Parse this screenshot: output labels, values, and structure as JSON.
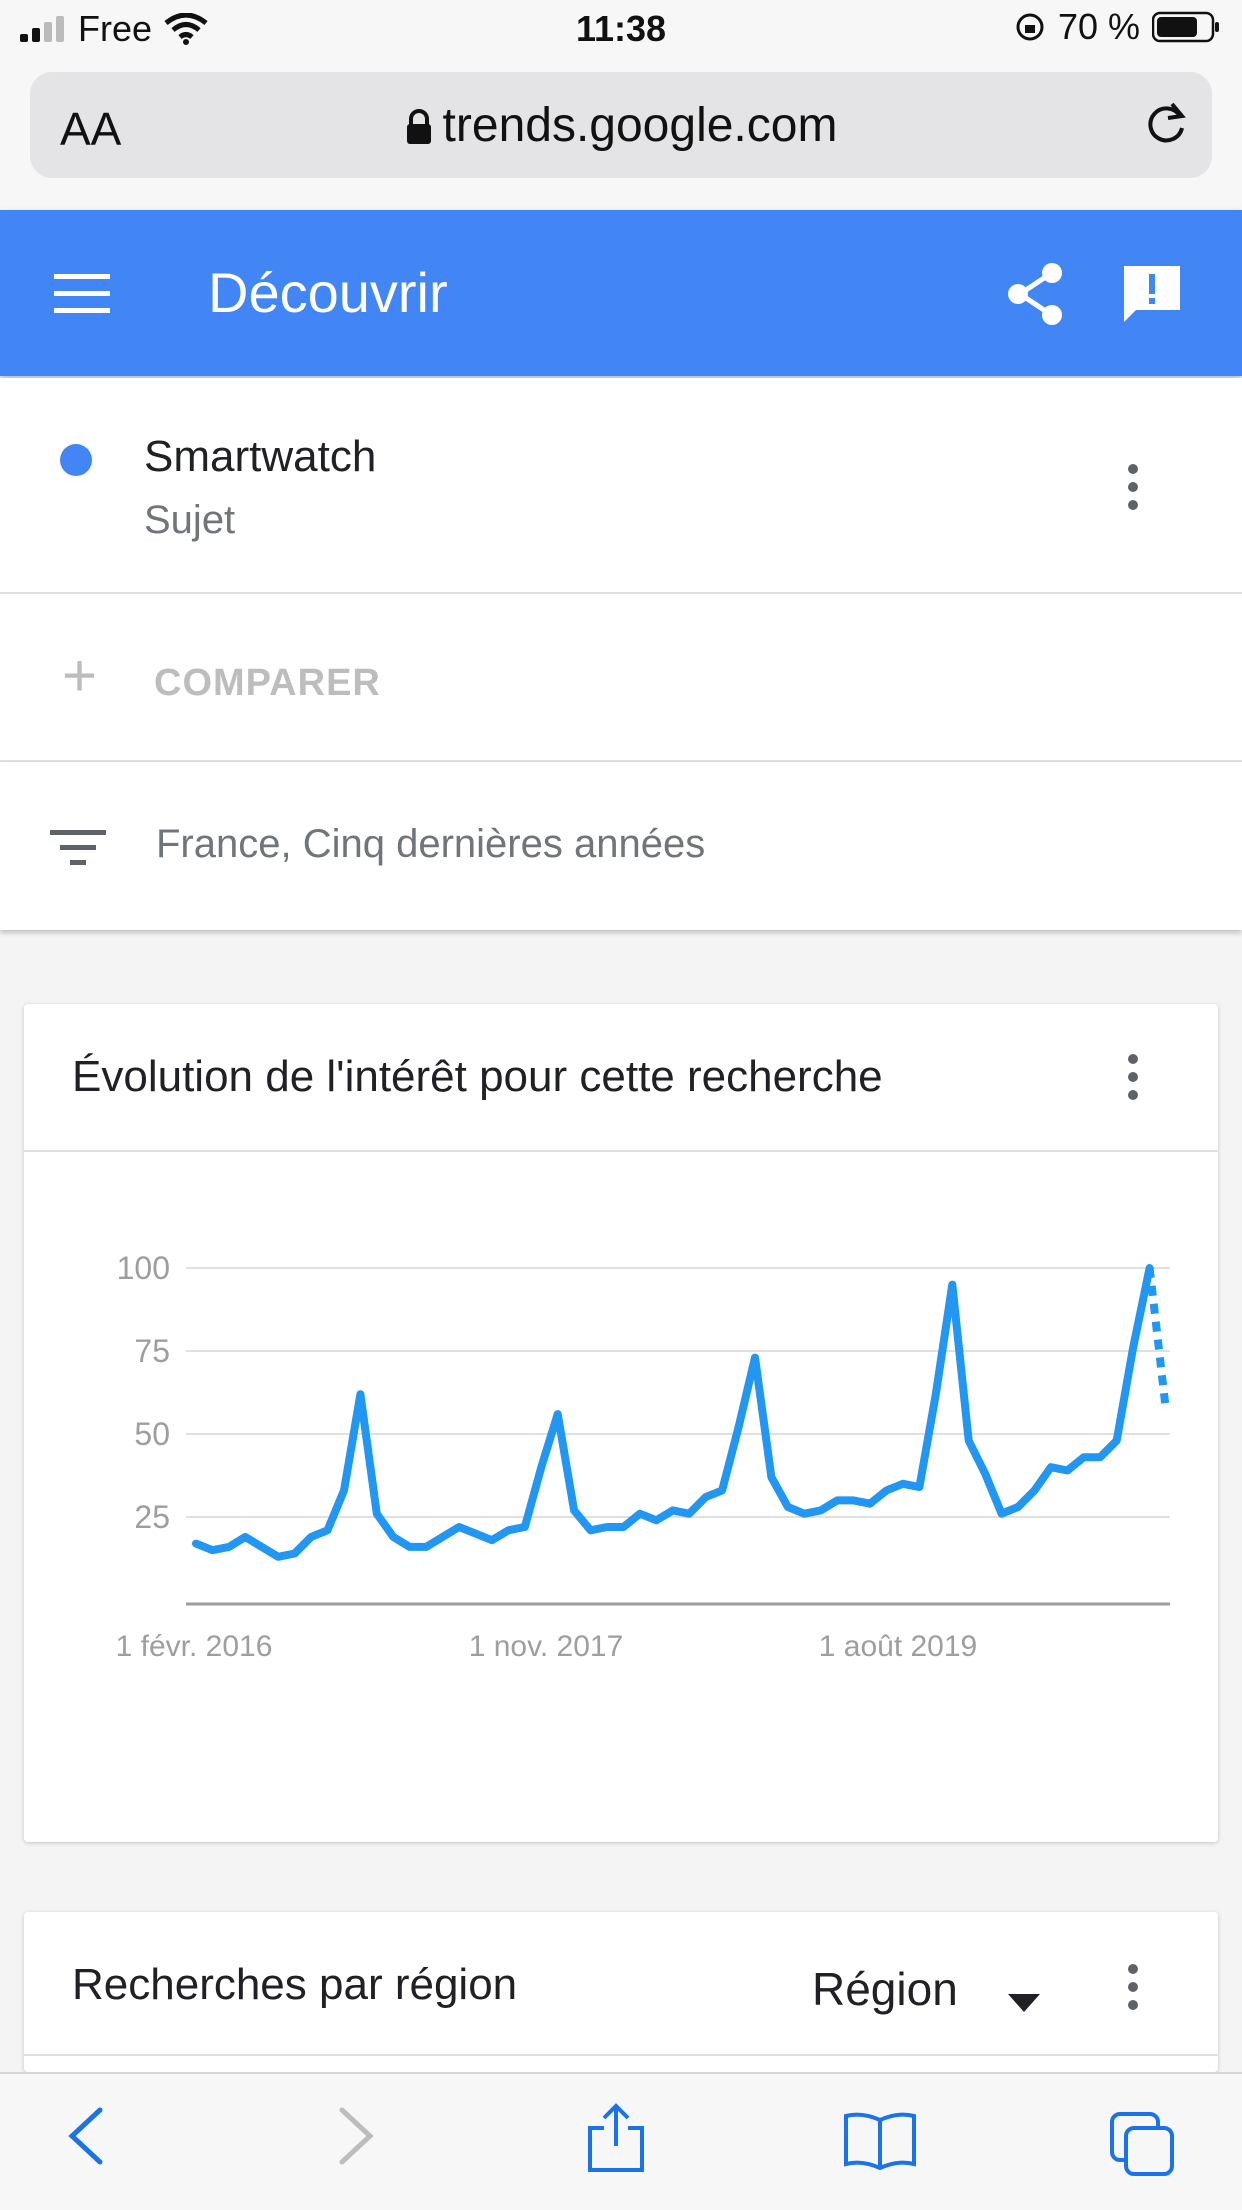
{
  "status": {
    "carrier": "Free",
    "time": "11:38",
    "battery": "70 %"
  },
  "browser": {
    "text_size_label": "AA",
    "host": "trends.google.com"
  },
  "appbar": {
    "title": "Découvrir"
  },
  "term": {
    "name": "Smartwatch",
    "type": "Sujet"
  },
  "compare": {
    "label": "COMPARER"
  },
  "filter": {
    "label": "France, Cinq dernières années"
  },
  "interest_card": {
    "title": "Évolution de l'intérêt pour cette recherche"
  },
  "region_card": {
    "title": "Recherches par région",
    "selector": "Région"
  },
  "colors": {
    "brand_blue": "#4285f4",
    "series_blue": "#2196f3"
  },
  "chart_data": {
    "type": "line",
    "ylim": [
      0,
      100
    ],
    "y_ticks": [
      "100",
      "75",
      "50",
      "25"
    ],
    "x_tick_labels": [
      "1 févr. 2016",
      "1 nov. 2017",
      "1 août 2019"
    ],
    "series": [
      {
        "values": [
          17,
          15,
          16,
          19,
          16,
          13,
          14,
          19,
          21,
          33,
          62,
          26,
          19,
          16,
          16,
          19,
          22,
          20,
          18,
          21,
          22,
          40,
          56,
          27,
          21,
          22,
          22,
          26,
          24,
          27,
          26,
          31,
          33,
          52,
          73,
          37,
          28,
          26,
          27,
          30,
          30,
          29,
          33,
          35,
          34,
          62,
          95,
          48,
          38,
          26,
          28,
          33,
          40,
          39,
          43,
          43,
          48,
          76,
          100
        ],
        "partial_values": [
          100,
          57
        ]
      }
    ]
  }
}
